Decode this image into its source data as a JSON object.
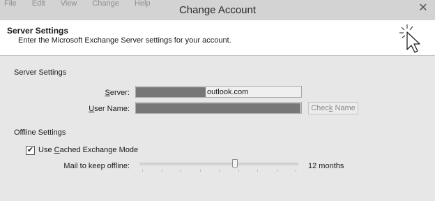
{
  "window": {
    "title": "Change Account",
    "background_menu_items": [
      "File",
      "Edit",
      "View",
      "Change",
      "Help"
    ]
  },
  "header": {
    "title": "Server Settings",
    "subtitle": "Enter the Microsoft Exchange Server settings for your account."
  },
  "server_settings": {
    "section_label": "Server Settings",
    "server": {
      "label_underlined": "S",
      "label_rest": "erver:",
      "value_visible": "outlook.com"
    },
    "user_name": {
      "label_underlined": "U",
      "label_rest": "ser Name:"
    },
    "check_name_button": {
      "label_prefix": "Chec",
      "label_underlined": "k",
      "label_suffix": " Name"
    }
  },
  "offline_settings": {
    "section_label": "Offline Settings",
    "cached_mode": {
      "checked": true,
      "label_prefix": "Use ",
      "label_underlined": "C",
      "label_suffix": "ached Exchange Mode"
    },
    "mail_to_keep": {
      "label": "Mail to keep offline:",
      "value": "12 months",
      "slider_level": 0.6
    }
  },
  "colors": {
    "titlebar": "#d3d3d3",
    "dialog": "#e7e7e7",
    "header": "#ffffff",
    "redaction": "#777777"
  }
}
